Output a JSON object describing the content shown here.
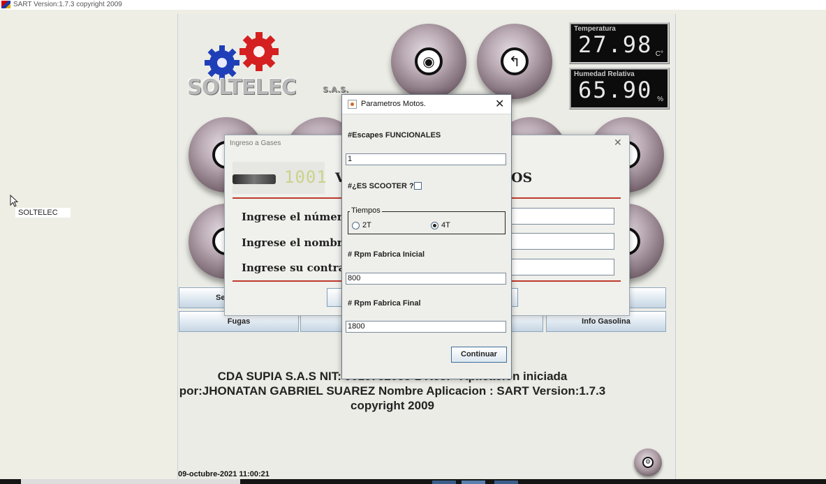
{
  "window": {
    "title": "SART Version:1.7.3 copyright  2009"
  },
  "desktop": {
    "label": "SOLTELEC"
  },
  "logo": {
    "brand": "SOLTELEC",
    "suffix": "S.A.S."
  },
  "sensors": {
    "temperature": {
      "label": "Temperatura",
      "value": "27.98",
      "unit": "C°"
    },
    "humidity": {
      "label": "Humedad Relativa",
      "value": "65.90",
      "unit": "%"
    }
  },
  "buttons": {
    "row1_left_label": "Se",
    "fugas": "Fugas",
    "info_gasolina": "Info Gasolina"
  },
  "footer": {
    "line1": "CDA SUPIA S.A.S NIT: 9013782088-1 Res:",
    "line1_end": "Aplicacion iniciada",
    "line2": "por:JHONATAN GABRIEL SUAREZ Nombre Aplicacion : SART Version:1.7.3",
    "line3": "copyright 2009"
  },
  "datestamp": "09-octubre-2021 11:00:21",
  "gases_dialog": {
    "title": "Ingreso a Gases",
    "banner_text": "1001",
    "heading_start": "V",
    "heading_end": "OS",
    "labels": {
      "user_number": "Ingrese el número de",
      "user_name": "Ingrese el nombre de",
      "password": "Ingrese su contraseñ"
    }
  },
  "motos_dialog": {
    "title": "Parametros Motos.",
    "escapes_label": "#Escapes FUNCIONALES",
    "escapes_value": "1",
    "scooter_label": "#¿ES SCOOTER ?",
    "tiempos_legend": "Tiempos",
    "option_2t": "2T",
    "option_4t": "4T",
    "rpm_initial_label": "# Rpm Fabrica Inicial",
    "rpm_initial_value": "800",
    "rpm_final_label": "# Rpm Fabrica Final",
    "rpm_final_value": "1800",
    "continue_label": "Continuar"
  },
  "icons": [
    "app-icon",
    "cursor-icon",
    "eye-icon",
    "road-sign-icon",
    "settings-icon",
    "close-icon",
    "java-icon"
  ]
}
